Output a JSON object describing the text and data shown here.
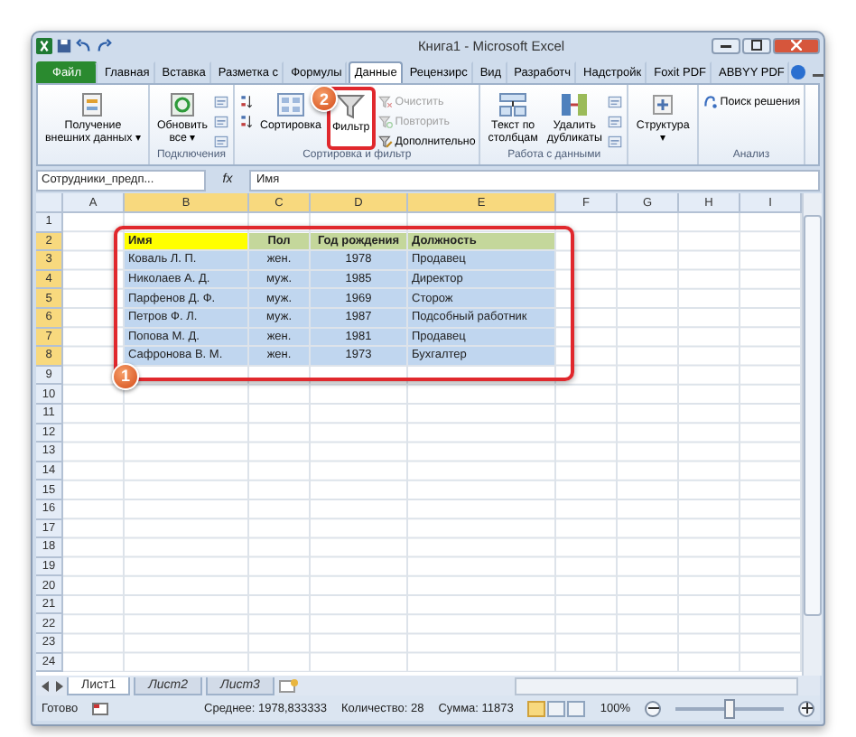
{
  "window": {
    "title": "Книга1 - Microsoft Excel"
  },
  "tabs": [
    {
      "label": "Файл",
      "kind": "file",
      "selected": false
    },
    {
      "label": "Главная",
      "kind": "tab",
      "selected": false
    },
    {
      "label": "Вставка",
      "kind": "tab",
      "selected": false
    },
    {
      "label": "Разметка с",
      "kind": "tab",
      "selected": false
    },
    {
      "label": "Формулы",
      "kind": "tab",
      "selected": false
    },
    {
      "label": "Данные",
      "kind": "tab",
      "selected": true
    },
    {
      "label": "Рецензирс",
      "kind": "tab",
      "selected": false
    },
    {
      "label": "Вид",
      "kind": "tab",
      "selected": false
    },
    {
      "label": "Разработч",
      "kind": "tab",
      "selected": false
    },
    {
      "label": "Надстройк",
      "kind": "tab",
      "selected": false
    },
    {
      "label": "Foxit PDF",
      "kind": "tab",
      "selected": false
    },
    {
      "label": "ABBYY PDF",
      "kind": "tab",
      "selected": false
    }
  ],
  "ribbon": {
    "groups": [
      {
        "buttons": [
          {
            "kind": "large",
            "label": "Получение\nвнешних данных ▾"
          }
        ]
      },
      {
        "label": "Подключения",
        "buttons": [
          {
            "kind": "large",
            "label": "Обновить\nвсе ▾"
          },
          {
            "kind": "small"
          },
          {
            "kind": "small"
          },
          {
            "kind": "small"
          }
        ]
      },
      {
        "label": "Сортировка и фильтр",
        "buttons": [
          {
            "kind": "small"
          },
          {
            "kind": "small"
          },
          {
            "kind": "large",
            "label": "Сортировка"
          },
          {
            "kind": "large",
            "label": "Фильтр",
            "callout": "2"
          },
          {
            "kind": "small",
            "label": "Очистить",
            "disabled": true
          },
          {
            "kind": "small",
            "label": "Повторить",
            "disabled": true
          },
          {
            "kind": "small",
            "label": "Дополнительно",
            "disabled": false
          }
        ]
      },
      {
        "label": "Работа с данными",
        "buttons": [
          {
            "kind": "large",
            "label": "Текст по\nстолбцам"
          },
          {
            "kind": "large",
            "label": "Удалить\nдубликаты"
          },
          {
            "kind": "small"
          },
          {
            "kind": "small"
          },
          {
            "kind": "small"
          }
        ]
      },
      {
        "buttons": [
          {
            "kind": "large",
            "label": "Структура\n▾"
          }
        ]
      },
      {
        "label": "Анализ",
        "buttons": [
          {
            "kind": "small",
            "label": "Поиск решения"
          }
        ]
      }
    ]
  },
  "formula_bar": {
    "name_box": "Сотрудники_предп...",
    "fx": "fx",
    "value": "Имя"
  },
  "sheet": {
    "columns": [
      {
        "label": "A",
        "selected": false
      },
      {
        "label": "B",
        "selected": true
      },
      {
        "label": "C",
        "selected": true
      },
      {
        "label": "D",
        "selected": true
      },
      {
        "label": "E",
        "selected": true
      },
      {
        "label": "F",
        "selected": false
      },
      {
        "label": "G",
        "selected": false
      },
      {
        "label": "H",
        "selected": false
      },
      {
        "label": "I",
        "selected": false
      }
    ],
    "rows": [
      {
        "label": "1",
        "selected": false
      },
      {
        "label": "2",
        "selected": true
      },
      {
        "label": "3",
        "selected": true
      },
      {
        "label": "4",
        "selected": true
      },
      {
        "label": "5",
        "selected": true
      },
      {
        "label": "6",
        "selected": true
      },
      {
        "label": "7",
        "selected": true
      },
      {
        "label": "8",
        "selected": true
      },
      {
        "label": "9",
        "selected": false
      },
      {
        "label": "10",
        "selected": false
      },
      {
        "label": "11",
        "selected": false
      },
      {
        "label": "12",
        "selected": false
      },
      {
        "label": "13",
        "selected": false
      },
      {
        "label": "14",
        "selected": false
      },
      {
        "label": "15",
        "selected": false
      },
      {
        "label": "16",
        "selected": false
      },
      {
        "label": "17",
        "selected": false
      },
      {
        "label": "18",
        "selected": false
      },
      {
        "label": "19",
        "selected": false
      },
      {
        "label": "20",
        "selected": false
      },
      {
        "label": "21",
        "selected": false
      },
      {
        "label": "22",
        "selected": false
      },
      {
        "label": "23",
        "selected": false
      },
      {
        "label": "24",
        "selected": false
      }
    ],
    "table": {
      "selected": true,
      "callout": "1",
      "header": [
        {
          "text": "Имя",
          "color": "#ffff00"
        },
        {
          "text": "Пол",
          "color": "#c4d79b"
        },
        {
          "text": "Год рождения",
          "color": "#c4d79b"
        },
        {
          "text": "Должность",
          "color": "#c4d79b"
        }
      ],
      "rows": [
        [
          "Коваль Л. П.",
          "жен.",
          "1978",
          "Продавец"
        ],
        [
          "Николаев А. Д.",
          "муж.",
          "1985",
          "Директор"
        ],
        [
          "Парфенов Д. Ф.",
          "муж.",
          "1969",
          "Сторож"
        ],
        [
          "Петров Ф. Л.",
          "муж.",
          "1987",
          "Подсобный работник"
        ],
        [
          "Попова М. Д.",
          "жен.",
          "1981",
          "Продавец"
        ],
        [
          "Сафронова В. М.",
          "жен.",
          "1973",
          "Бухгалтер"
        ]
      ]
    }
  },
  "sheet_tabs": [
    {
      "label": "Лист1",
      "selected": true
    },
    {
      "label": "Лист2",
      "selected": false
    },
    {
      "label": "Лист3",
      "selected": false
    }
  ],
  "status_bar": {
    "mode": "Готово",
    "average": "Среднее: 1978,833333",
    "count": "Количество: 28",
    "sum": "Сумма: 11873",
    "views": [
      {
        "selected": true
      },
      {
        "selected": false
      },
      {
        "selected": false
      }
    ],
    "zoom": "100%",
    "zoom_slider": {
      "level": 0.5
    }
  }
}
